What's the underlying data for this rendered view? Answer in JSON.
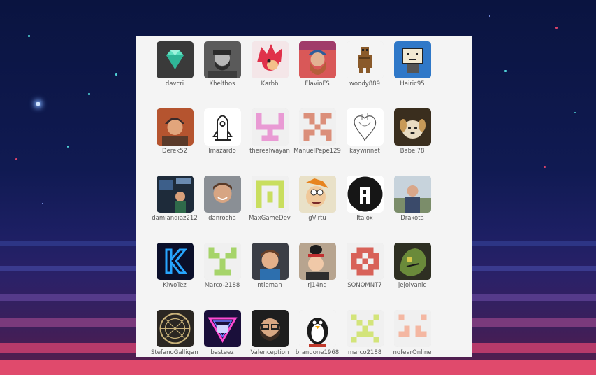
{
  "users": [
    {
      "name": "davcri",
      "icon": "diamond-icon"
    },
    {
      "name": "Khelthos",
      "icon": "photo-bearded-man"
    },
    {
      "name": "Karbb",
      "icon": "red-hedgehog-avatar"
    },
    {
      "name": "FlavioFS",
      "icon": "photo-bearded-beanie"
    },
    {
      "name": "woody889",
      "icon": "pixel-chewbacca"
    },
    {
      "name": "Hairic95",
      "icon": "tv-robot-avatar"
    },
    {
      "name": "Derek52",
      "icon": "photo-person-beanie"
    },
    {
      "name": "lmazardo",
      "icon": "rocket-line-icon"
    },
    {
      "name": "therealwayan",
      "icon": "identicon-pink"
    },
    {
      "name": "ManuelPepe129",
      "icon": "identicon-salmon"
    },
    {
      "name": "kaywinnet",
      "icon": "anatomical-heart-sketch"
    },
    {
      "name": "Babel78",
      "icon": "photo-dog"
    },
    {
      "name": "damiandiaz212",
      "icon": "photo-arena-person"
    },
    {
      "name": "danrocha",
      "icon": "photo-smiling-man"
    },
    {
      "name": "MaxGameDev",
      "icon": "identicon-lime"
    },
    {
      "name": "gVirtu",
      "icon": "cartoon-face"
    },
    {
      "name": "Italox",
      "icon": "letter-a-logo"
    },
    {
      "name": "Drakota",
      "icon": "photo-man-outdoors"
    },
    {
      "name": "KiwoTez",
      "icon": "neon-k-logo"
    },
    {
      "name": "Marco-2188",
      "icon": "identicon-green"
    },
    {
      "name": "ntieman",
      "icon": "photo-boy"
    },
    {
      "name": "rj14ng",
      "icon": "photo-woman-penguin"
    },
    {
      "name": "SONOMNT7",
      "icon": "identicon-red"
    },
    {
      "name": "jejoivanic",
      "icon": "green-creature-art"
    },
    {
      "name": "StefanoGalligani",
      "icon": "rune-circle-icon"
    },
    {
      "name": "basteez",
      "icon": "neon-triangle-logo"
    },
    {
      "name": "Valenception",
      "icon": "photo-man-glasses"
    },
    {
      "name": "brandone1968",
      "icon": "penguin-icon"
    },
    {
      "name": "marco2188",
      "icon": "identicon-yellowgreen"
    },
    {
      "name": "nofearOnline",
      "icon": "identicon-peach"
    }
  ],
  "colors": {
    "panel": "#f4f4f4",
    "label": "#555555",
    "identicon_pink": "#e99ad4",
    "identicon_salmon": "#db8f7a",
    "identicon_lime": "#c9de5e",
    "identicon_green": "#a6d46a",
    "identicon_red": "#d86259",
    "identicon_yellowgreen": "#d3e47a",
    "identicon_peach": "#f4b7a2"
  }
}
